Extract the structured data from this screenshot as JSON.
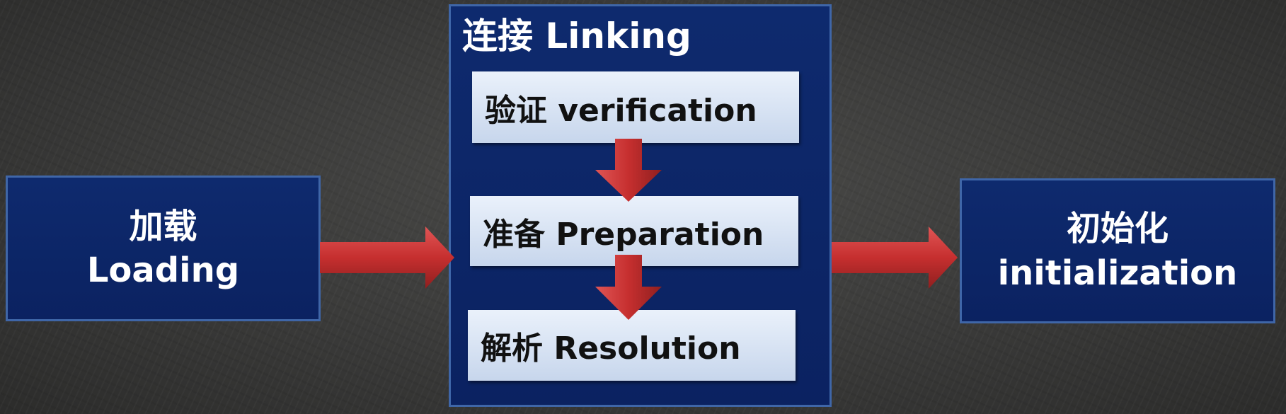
{
  "stages": {
    "loading": {
      "zh": "加载",
      "en": "Loading"
    },
    "linking": {
      "title": "连接 Linking",
      "steps": [
        {
          "label": "验证 verification"
        },
        {
          "label": "准备 Preparation"
        },
        {
          "label": "解析 Resolution"
        }
      ]
    },
    "initialization": {
      "zh": "初始化",
      "en": "initialization"
    }
  },
  "colors": {
    "box_fill": "#0e2a6e",
    "box_border": "#3f66a8",
    "step_fill": "#dbe6f5",
    "arrow": "#c62f2f"
  }
}
